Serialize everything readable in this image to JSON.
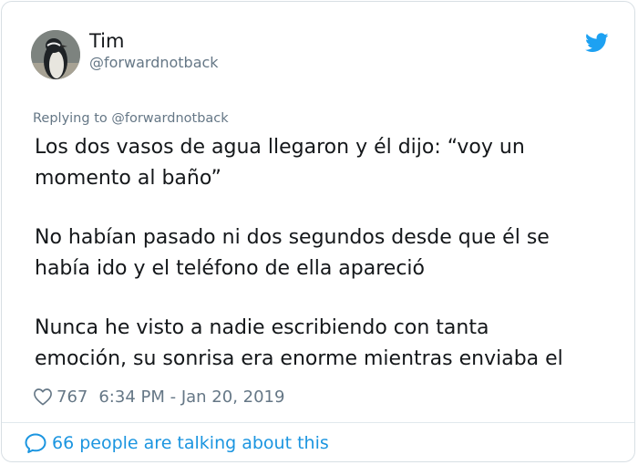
{
  "tweet": {
    "display_name": "Tim",
    "handle": "@forwardnotback",
    "replying_to": "Replying to @forwardnotback",
    "lines": [
      "Los dos vasos de agua llegaron y él dijo: “voy un",
      "momento al baño”",
      "No habían pasado ni dos segundos desde que él se",
      "había ido y el teléfono de ella apareció",
      "Nunca he visto a nadie escribiendo con tanta",
      "emoción, su sonrisa era enorme mientras enviaba el"
    ],
    "likes": "767",
    "timestamp": "6:34 PM - Jan 20, 2019",
    "talking": "66 people are talking about this"
  },
  "icons": {
    "brand": "twitter-bird-icon",
    "like": "heart-outline-icon",
    "reply": "speech-bubble-icon"
  },
  "colors": {
    "brand_blue": "#1da1f2",
    "link_blue": "#1b95e0",
    "secondary_text": "#657786",
    "primary_text": "#14171a"
  }
}
